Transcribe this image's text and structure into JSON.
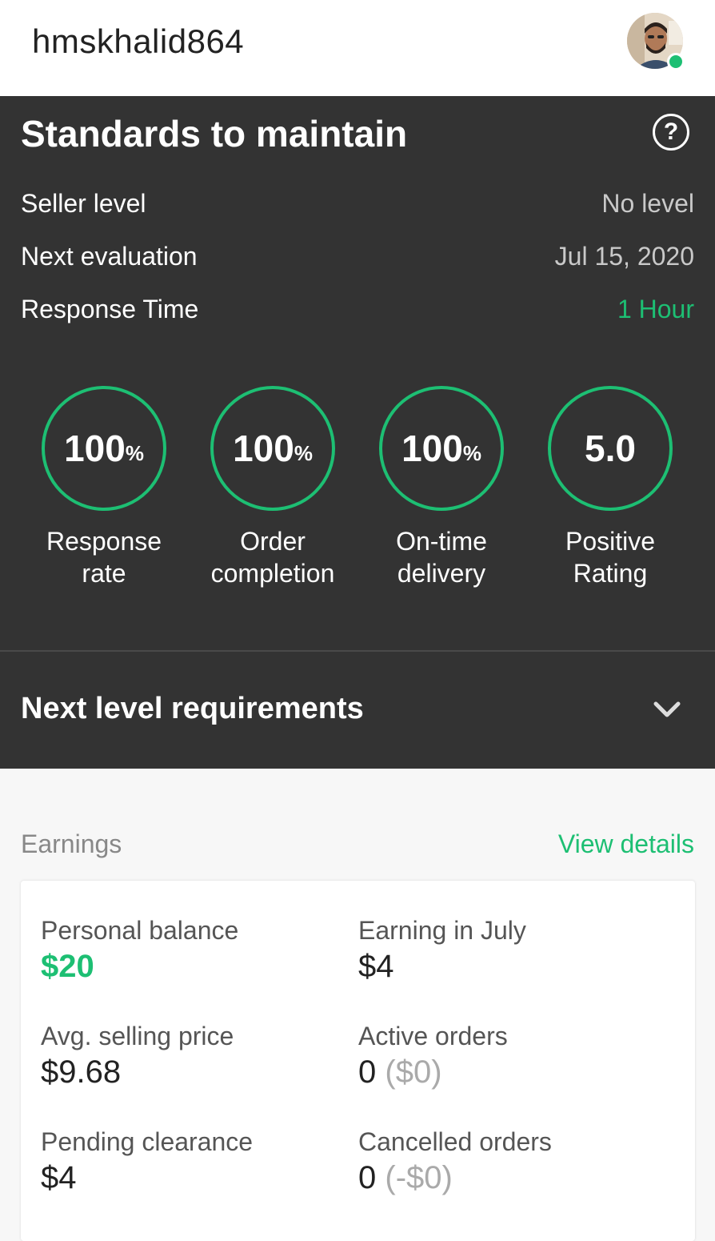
{
  "header": {
    "username": "hmskhalid864"
  },
  "standards": {
    "title": "Standards to maintain",
    "help_icon": "?",
    "rows": [
      {
        "label": "Seller level",
        "value": "No level"
      },
      {
        "label": "Next evaluation",
        "value": "Jul 15, 2020"
      },
      {
        "label": "Response Time",
        "value": "1 Hour"
      }
    ],
    "metrics": [
      {
        "value": "100",
        "unit": "%",
        "label_line1": "Response",
        "label_line2": "rate"
      },
      {
        "value": "100",
        "unit": "%",
        "label_line1": "Order",
        "label_line2": "completion"
      },
      {
        "value": "100",
        "unit": "%",
        "label_line1": "On-time",
        "label_line2": "delivery"
      },
      {
        "value": "5.0",
        "unit": "",
        "label_line1": "Positive",
        "label_line2": "Rating"
      }
    ],
    "next_level_label": "Next level requirements"
  },
  "earnings": {
    "title": "Earnings",
    "view_details": "View details",
    "stats": [
      {
        "label": "Personal balance",
        "value": "$20"
      },
      {
        "label": "Earning in July",
        "value": "$4"
      },
      {
        "label": "Avg. selling price",
        "value": "$9.68"
      },
      {
        "label": "Active orders",
        "value": "0",
        "sub": "($0)"
      },
      {
        "label": "Pending clearance",
        "value": "$4"
      },
      {
        "label": "Cancelled orders",
        "value": "0",
        "sub": "(-$0)"
      }
    ]
  },
  "colors": {
    "accent": "#1dbf73",
    "dark_panel": "#333333",
    "muted_text": "#888888"
  },
  "icons": {
    "help": "help-circle-icon",
    "expand": "chevron-down-icon",
    "online": "online-status-icon"
  }
}
